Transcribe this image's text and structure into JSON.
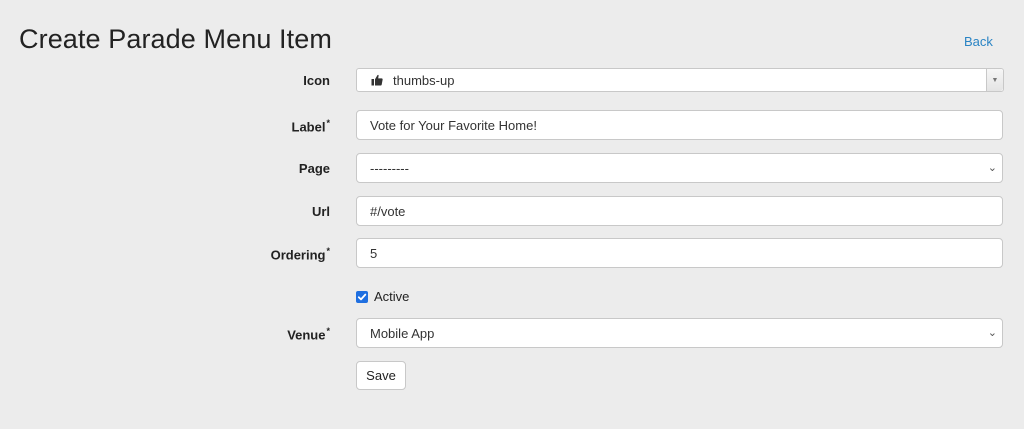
{
  "page": {
    "title": "Create Parade Menu Item",
    "back_label": "Back"
  },
  "form": {
    "icon": {
      "label": "Icon",
      "value": "thumbs-up",
      "icon_name": "thumbs-up-icon"
    },
    "label_field": {
      "label": "Label",
      "required_mark": "*",
      "value": "Vote for Your Favorite Home!"
    },
    "page_field": {
      "label": "Page",
      "value": "---------"
    },
    "url_field": {
      "label": "Url",
      "value": "#/vote"
    },
    "ordering_field": {
      "label": "Ordering",
      "required_mark": "*",
      "value": "5"
    },
    "active": {
      "label": "Active",
      "checked": true
    },
    "venue_field": {
      "label": "Venue",
      "required_mark": "*",
      "value": "Mobile App"
    },
    "save_label": "Save"
  },
  "colors": {
    "background": "#ececec",
    "link": "#2a84c4",
    "checkbox": "#1f6fe0"
  }
}
